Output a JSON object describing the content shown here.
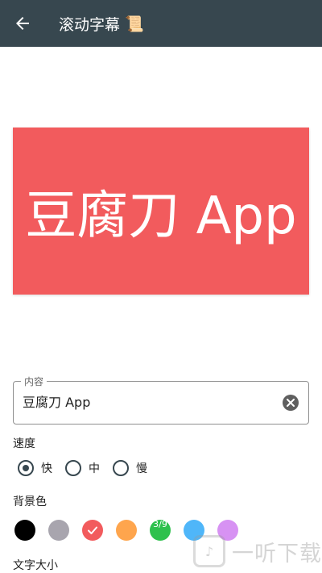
{
  "appbar": {
    "title": "滚动字幕",
    "title_icon": "📜",
    "back_icon": "arrow-back-icon"
  },
  "preview": {
    "text": "豆腐刀 App",
    "background": "#f25b5d",
    "text_color": "#ffffff"
  },
  "content_field": {
    "label": "内容",
    "value": "豆腐刀 App",
    "clear_icon": "clear-circle-icon"
  },
  "speed": {
    "label": "速度",
    "options": [
      {
        "label": "快",
        "checked": true
      },
      {
        "label": "中",
        "checked": false
      },
      {
        "label": "慢",
        "checked": false
      }
    ]
  },
  "background_color": {
    "label": "背景色",
    "colors": [
      "#000000",
      "#a8a5ae",
      "#f25b5d",
      "#fea54d",
      "#2ec14d",
      "#4fb6f9",
      "#d792f3"
    ],
    "selected": "#f25b5d",
    "badge_on_green": "3/9"
  },
  "font_size": {
    "label": "文字大小"
  },
  "watermark": {
    "text": "一听下载"
  }
}
